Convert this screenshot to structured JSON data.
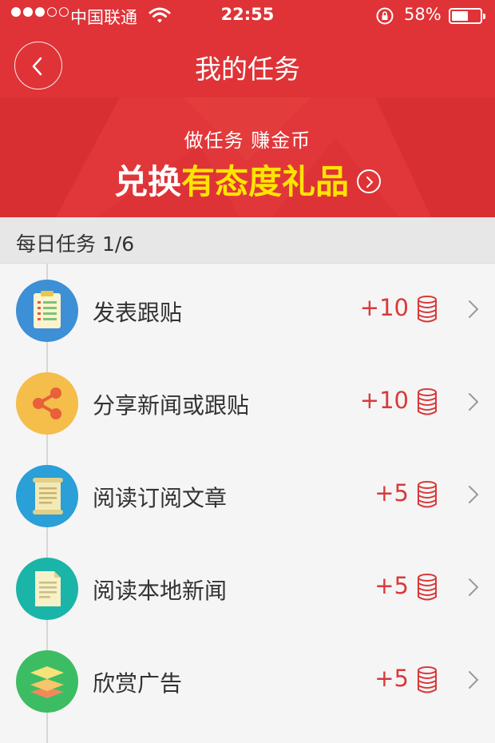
{
  "status_bar": {
    "carrier": "中国联通",
    "time": "22:55",
    "battery": "58%",
    "battery_level": 0.58,
    "signal_bars": 3,
    "signal_total": 5
  },
  "nav": {
    "title": "我的任务",
    "back_icon": "chevron-left-icon"
  },
  "banner": {
    "subtitle": "做任务 赚金币",
    "headline_white": "兑换",
    "headline_yellow": "有态度礼品",
    "colors": {
      "background": "#df3337",
      "highlight": "#ffe400"
    }
  },
  "section": {
    "title": "每日任务 1/6"
  },
  "tasks": [
    {
      "label": "发表跟贴",
      "reward": "+10",
      "icon": "clipboard-icon",
      "color": "#3d8fd6"
    },
    {
      "label": "分享新闻或跟贴",
      "reward": "+10",
      "icon": "share-icon",
      "color": "#f5bd4a"
    },
    {
      "label": "阅读订阅文章",
      "reward": "+5",
      "icon": "scroll-icon",
      "color": "#2a9fd8"
    },
    {
      "label": "阅读本地新闻",
      "reward": "+5",
      "icon": "document-icon",
      "color": "#1ab5a8"
    },
    {
      "label": "欣赏广告",
      "reward": "+5",
      "icon": "layers-icon",
      "color": "#3cbd63"
    }
  ],
  "colors": {
    "accent": "#df3337",
    "reward": "#d9393a"
  }
}
